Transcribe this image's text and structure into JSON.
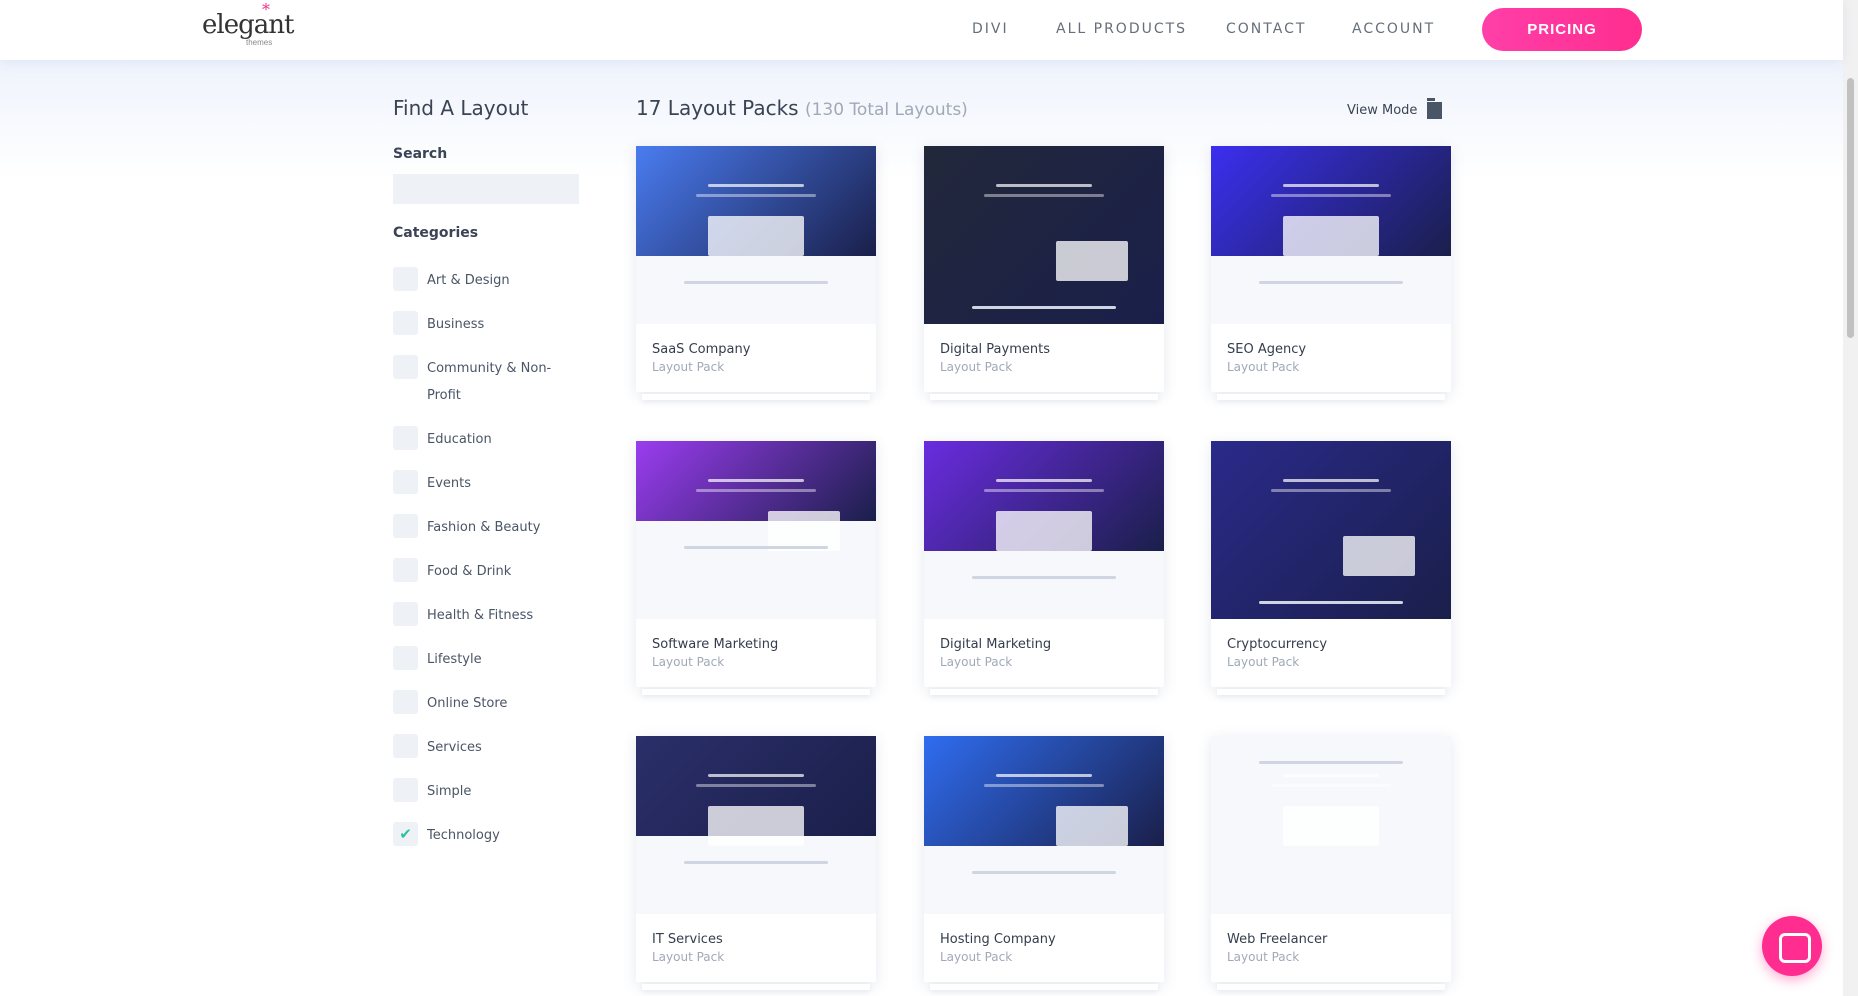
{
  "header": {
    "logo": "elegant themes",
    "nav": [
      "DIVI",
      "ALL PRODUCTS",
      "CONTACT",
      "ACCOUNT"
    ],
    "pricing": "PRICING"
  },
  "sidebar": {
    "title": "Find A Layout",
    "search_label": "Search",
    "search_value": "",
    "categories_label": "Categories",
    "categories": [
      {
        "label": "Art & Design",
        "checked": false
      },
      {
        "label": "Business",
        "checked": false
      },
      {
        "label": "Community & Non-Profit",
        "checked": false
      },
      {
        "label": "Education",
        "checked": false
      },
      {
        "label": "Events",
        "checked": false
      },
      {
        "label": "Fashion & Beauty",
        "checked": false
      },
      {
        "label": "Food & Drink",
        "checked": false
      },
      {
        "label": "Health & Fitness",
        "checked": false
      },
      {
        "label": "Lifestyle",
        "checked": false
      },
      {
        "label": "Online Store",
        "checked": false
      },
      {
        "label": "Services",
        "checked": false
      },
      {
        "label": "Simple",
        "checked": false
      },
      {
        "label": "Technology",
        "checked": true
      }
    ]
  },
  "main": {
    "title": "17 Layout Packs",
    "total": "(130 Total Layouts)",
    "view_mode": "View Mode",
    "cards": [
      {
        "title": "SaaS Company",
        "subtitle": "Layout Pack",
        "color": "#4a7cf0"
      },
      {
        "title": "Digital Payments",
        "subtitle": "Layout Pack",
        "color": "#22283a"
      },
      {
        "title": "SEO Agency",
        "subtitle": "Layout Pack",
        "color": "#3b2ff0"
      },
      {
        "title": "Software Marketing",
        "subtitle": "Layout Pack",
        "color": "#9b3cf0"
      },
      {
        "title": "Digital Marketing",
        "subtitle": "Layout Pack",
        "color": "#6a2ce0"
      },
      {
        "title": "Cryptocurrency",
        "subtitle": "Layout Pack",
        "color": "#2a2a8a"
      },
      {
        "title": "IT Services",
        "subtitle": "Layout Pack",
        "color": "#2b2f6a"
      },
      {
        "title": "Hosting Company",
        "subtitle": "Layout Pack",
        "color": "#2f6df0"
      },
      {
        "title": "Web Freelancer",
        "subtitle": "Layout Pack",
        "color": "#ffffff"
      }
    ]
  },
  "colors": {
    "accent": "#ff2d8f",
    "check": "#2fbf9f"
  }
}
